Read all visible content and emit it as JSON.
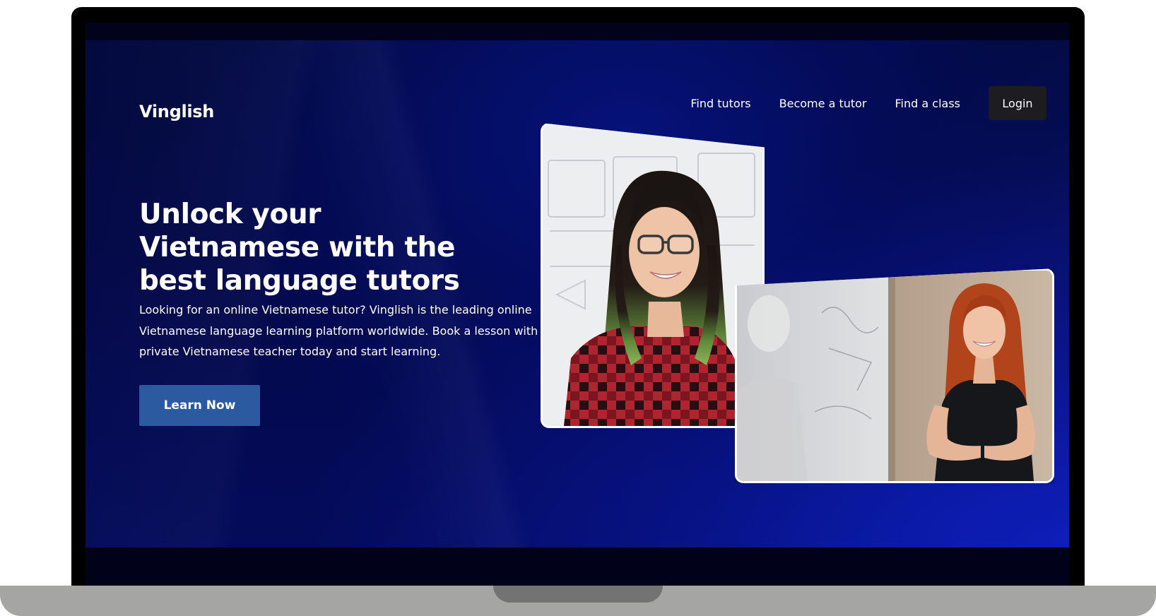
{
  "brand": {
    "name": "Vinglish"
  },
  "nav": {
    "links": [
      {
        "label": "Find tutors"
      },
      {
        "label": "Become a tutor"
      },
      {
        "label": "Find a class"
      }
    ],
    "login_label": "Login"
  },
  "hero": {
    "headline": "Unlock your Vietnamese with the best language tutors",
    "description": "Looking for an online Vietnamese tutor? Vinglish is the leading online Vietnamese language learning platform worldwide. Book a lesson with a private Vietnamese teacher today and start learning.",
    "cta_label": "Learn Now"
  },
  "colors": {
    "cta_background": "#2b5aa0",
    "login_background": "#1c1c21",
    "hero_background": "#03094a"
  },
  "images": [
    {
      "icon": "tutor-photo-woman-glasses-plaid-shirt"
    },
    {
      "icon": "tutor-photo-woman-red-hair-whiteboard"
    }
  ]
}
